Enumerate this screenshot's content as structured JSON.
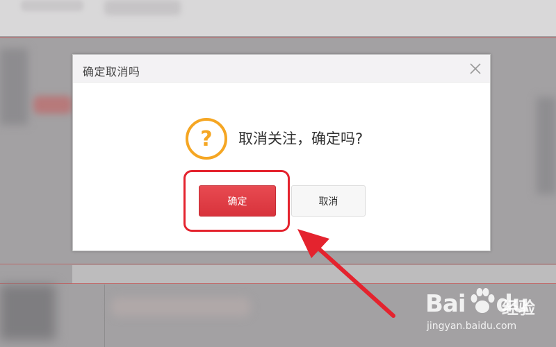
{
  "dialog": {
    "title": "确定取消吗",
    "message": "取消关注，确定吗?",
    "confirm_label": "确定",
    "cancel_label": "取消",
    "icon": "question-circle-icon",
    "close_icon": "close-icon"
  },
  "watermark": {
    "brand_latin_1": "Bai",
    "brand_latin_2": "du",
    "brand_cn": "经验",
    "url": "jingyan.baidu.com"
  },
  "colors": {
    "confirm": "#e0404a",
    "highlight": "#e4232e",
    "question_icon": "#f5a623",
    "overlay": "#a3a1a3"
  }
}
